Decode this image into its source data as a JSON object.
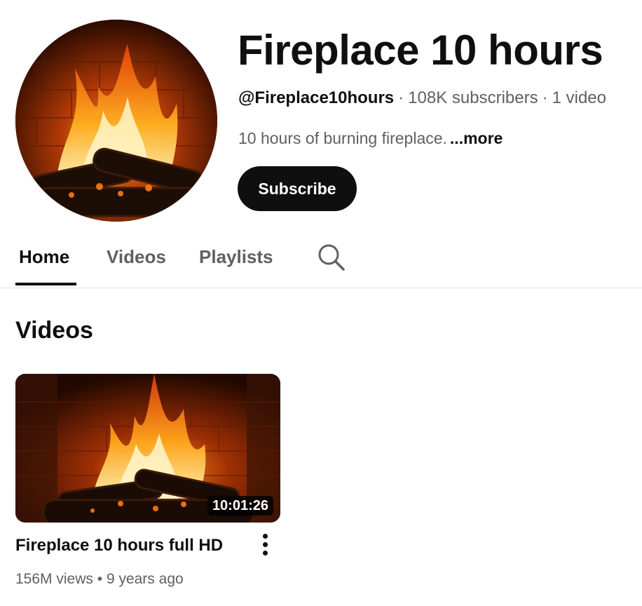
{
  "channel": {
    "name": "Fireplace 10 hours",
    "handle": "@Fireplace10hours",
    "subscribers": "108K subscribers",
    "video_count": "1 video",
    "separator": "·",
    "description": "10 hours of burning fireplace.",
    "more_label": "...more",
    "subscribe_label": "Subscribe"
  },
  "tabs": [
    {
      "label": "Home",
      "active": true
    },
    {
      "label": "Videos",
      "active": false
    },
    {
      "label": "Playlists",
      "active": false
    }
  ],
  "search_icon": "search-icon",
  "section": {
    "heading": "Videos",
    "videos": [
      {
        "title": "Fireplace 10 hours full HD",
        "duration": "10:01:26",
        "views": "156M views",
        "separator": "•",
        "age": "9 years ago",
        "menu_icon": "more-vertical-icon"
      }
    ]
  },
  "colors": {
    "text_primary": "#0f0f0f",
    "text_secondary": "#606060",
    "button_bg": "#0f0f0f",
    "divider": "#e5e5e5"
  }
}
